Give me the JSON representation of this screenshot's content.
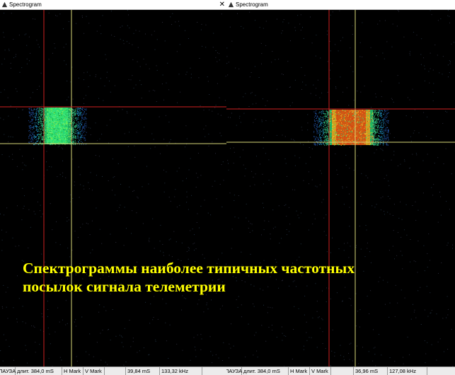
{
  "colors": {
    "background": "#000000",
    "marker_red": "#d02020",
    "marker_yellow": "#d8d878",
    "caption": "#ffff00"
  },
  "windows": [
    {
      "title": "Spectrogram",
      "close_glyph": "✕",
      "status": {
        "state": "ПАУЗА",
        "duration": "длит. 384,0 mS",
        "h_mark": "H Mark",
        "v_mark": "V Mark",
        "time": "39,84 mS",
        "freq": "133,32 kHz"
      }
    },
    {
      "title": "Spectrogram",
      "close_glyph": "",
      "status": {
        "state": "ПАУЗА",
        "duration": "длит. 384,0 mS",
        "h_mark": "H Mark",
        "v_mark": "V Mark",
        "time": "36,96 mS",
        "freq": "127,08 kHz"
      }
    }
  ],
  "caption": "Спектрограммы наиболее типичных частотных\nпосылок сигнала телеметрии"
}
